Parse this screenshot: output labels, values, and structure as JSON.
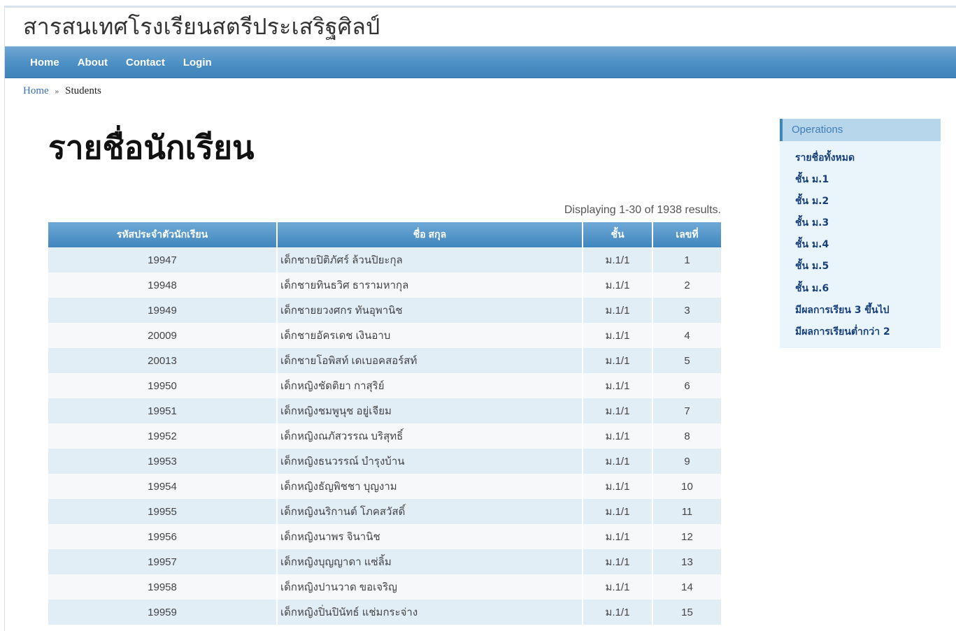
{
  "site": {
    "title": "สารสนเทศโรงเรียนสตรีประเสริฐศิลป์"
  },
  "menu": [
    {
      "label": "Home"
    },
    {
      "label": "About"
    },
    {
      "label": "Contact"
    },
    {
      "label": "Login"
    }
  ],
  "breadcrumb": {
    "home": "Home",
    "separator": "»",
    "current": "Students"
  },
  "page": {
    "title": "รายชื่อนักเรียน",
    "summary": "Displaying 1-30 of 1938 results."
  },
  "table": {
    "columns": [
      "รหัสประจำตัวนักเรียน",
      "ชื่อ สกุล",
      "ชั้น",
      "เลขที่"
    ],
    "rows": [
      [
        "19947",
        "เด็กชายปิติภัศร์ ล้วนปิยะกุล",
        "ม.1/1",
        "1"
      ],
      [
        "19948",
        "เด็กชายทินธวิศ ธารามหากุล",
        "ม.1/1",
        "2"
      ],
      [
        "19949",
        "เด็กชายยวงศกร ทันอุพานิช",
        "ม.1/1",
        "3"
      ],
      [
        "20009",
        "เด็กชายอัครเดช เงินอาบ",
        "ม.1/1",
        "4"
      ],
      [
        "20013",
        "เด็กชายโอพิสท์ เดเบอคสอร์สท์",
        "ม.1/1",
        "5"
      ],
      [
        "19950",
        "เด็กหญิงชัดติยา กาสุริย์",
        "ม.1/1",
        "6"
      ],
      [
        "19951",
        "เด็กหญิงชมพูนุช อยู่เจียม",
        "ม.1/1",
        "7"
      ],
      [
        "19952",
        "เด็กหญิงณภัสวรรณ บริสุทธิ์",
        "ม.1/1",
        "8"
      ],
      [
        "19953",
        "เด็กหญิงธนวรรณ์ บำรุงบ้าน",
        "ม.1/1",
        "9"
      ],
      [
        "19954",
        "เด็กหญิงธัญพิชชา บุญงาม",
        "ม.1/1",
        "10"
      ],
      [
        "19955",
        "เด็กหญิงนริกานต์ โภคสวัสดิ์",
        "ม.1/1",
        "11"
      ],
      [
        "19956",
        "เด็กหญิงนาพร จินานิช",
        "ม.1/1",
        "12"
      ],
      [
        "19957",
        "เด็กหญิงบุญญาดา แซ่ลิ้ม",
        "ม.1/1",
        "13"
      ],
      [
        "19958",
        "เด็กหญิงปานวาด ขอเจริญ",
        "ม.1/1",
        "14"
      ],
      [
        "19959",
        "เด็กหญิงปิ่นปินัทธ์ แช่มกระจ่าง",
        "ม.1/1",
        "15"
      ]
    ]
  },
  "sidebar": {
    "title": "Operations",
    "items": [
      "รายชื่อทั้งหมด",
      "ชั้น ม.1",
      "ชั้น ม.2",
      "ชั้น ม.3",
      "ชั้น ม.4",
      "ชั้น ม.5",
      "ชั้น ม.6",
      "มีผลการเรียน 3 ขึ้นไป",
      "มีผลการเรียนต่ำกว่า 2"
    ]
  }
}
